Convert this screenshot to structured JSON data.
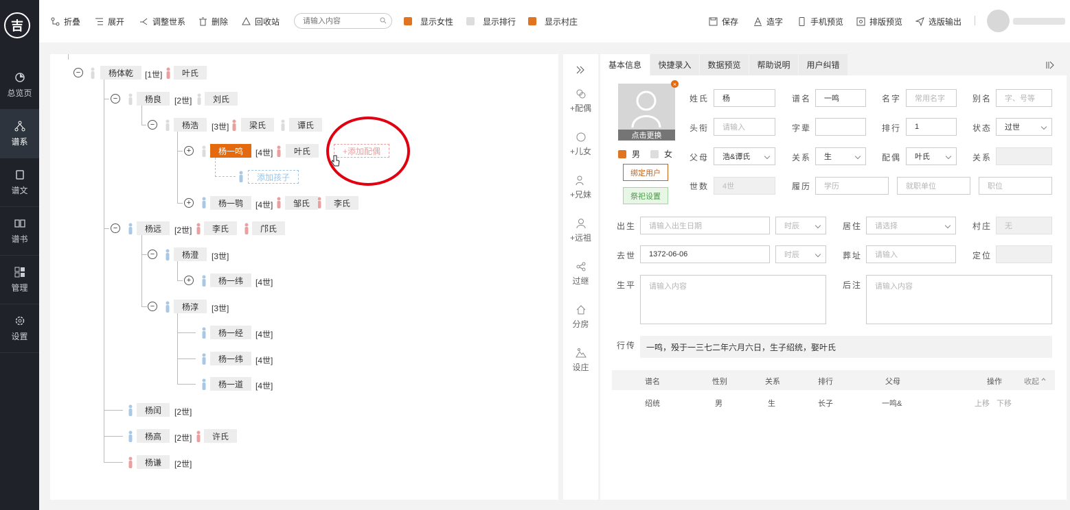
{
  "app": {
    "logo_text": "吉"
  },
  "sidebar": {
    "items": [
      {
        "label": "总览页",
        "icon": "pie-chart-icon"
      },
      {
        "label": "谱系",
        "icon": "tree-icon",
        "active": true
      },
      {
        "label": "谱文",
        "icon": "document-icon"
      },
      {
        "label": "谱书",
        "icon": "book-icon"
      },
      {
        "label": "管理",
        "icon": "grid-icon"
      },
      {
        "label": "设置",
        "icon": "gear-icon"
      }
    ]
  },
  "toolbar": {
    "fold": "折叠",
    "expand": "展开",
    "adjust": "调整世系",
    "delete": "删除",
    "recycle": "回收站",
    "search_placeholder": "请输入内容",
    "show_female": "显示女性",
    "show_rank": "显示排行",
    "show_village": "显示村庄",
    "save": "保存",
    "make_char": "造字",
    "mobile_preview": "手机预览",
    "layout_preview": "排版预览",
    "export": "选版输出"
  },
  "tree": {
    "nodes": {
      "n1": "杨体乾",
      "n1g": "[1世]",
      "n1s": "叶氏",
      "n2": "杨良",
      "n2g": "[2世]",
      "n2s": "刘氏",
      "n3": "杨浩",
      "n3g": "[3世]",
      "n3s1": "梁氏",
      "n3s2": "谭氏",
      "n4": "杨一鸣",
      "n4g": "[4世]",
      "n4s": "叶氏",
      "add_spouse": "+添加配偶",
      "add_child": "添加孩子",
      "n5": "杨一鹗",
      "n5g": "[4世]",
      "n5s1": "邹氏",
      "n5s2": "李氏",
      "n6": "杨远",
      "n6g": "[2世]",
      "n6s1": "李氏",
      "n6s2": "邝氏",
      "n7": "杨澄",
      "n7g": "[3世]",
      "n8": "杨一纬",
      "n8g": "[4世]",
      "n9": "杨淳",
      "n9g": "[3世]",
      "n10": "杨一经",
      "n10g": "[4世]",
      "n11": "杨一纬",
      "n11g": "[4世]",
      "n12": "杨一道",
      "n12g": "[4世]",
      "n13": "杨闰",
      "n13g": "[2世]",
      "n14": "杨高",
      "n14g": "[2世]",
      "n14s": "许氏",
      "n15": "杨谦",
      "n15g": "[2世]"
    }
  },
  "tools": [
    "+配偶",
    "+儿女",
    "+兄妹",
    "+远祖",
    "过继",
    "分房",
    "设庄"
  ],
  "tabs": [
    "基本信息",
    "快捷录入",
    "数据预览",
    "帮助说明",
    "用户纠错"
  ],
  "form": {
    "photo_caption": "点击更换",
    "male": "男",
    "female": "女",
    "bind_user": "绑定用户",
    "ritual": "祭祀设置",
    "labels": {
      "surname": "姓氏",
      "pu_name": "谱名",
      "given": "名字",
      "alias": "别名",
      "title": "头衔",
      "zibei": "字辈",
      "rank": "排行",
      "status": "状态",
      "parents": "父母",
      "relation": "关系",
      "spouse": "配偶",
      "relation2": "关系",
      "generation": "世数",
      "resume": "履历",
      "birth": "出生",
      "residence": "居住",
      "village": "村庄",
      "death": "去世",
      "burial": "葬址",
      "location": "定位",
      "life": "生平",
      "notes": "后注",
      "biography": "行传"
    },
    "values": {
      "surname": "杨",
      "pu_name": "一鸣",
      "rank": "1",
      "status": "过世",
      "parents": "浩&谭氏",
      "relation": "生",
      "spouse": "叶氏",
      "generation": "4世",
      "death_date": "1372-06-06",
      "village": "无",
      "biography": "一鸣，殁于一三七二年六月六日，生子绍统，娶叶氏"
    },
    "placeholders": {
      "given": "常用名字",
      "alias": "字、号等",
      "title": "请输入",
      "education": "学历",
      "employer": "就职单位",
      "position": "职位",
      "birth": "请输入出生日期",
      "hour": "时辰",
      "hour2": "时辰",
      "residence": "请选择",
      "burial": "请输入",
      "life": "请输入内容",
      "notes": "请输入内容"
    }
  },
  "children_table": {
    "headers": [
      "谱名",
      "性别",
      "关系",
      "排行",
      "父母",
      "操作",
      "收起"
    ],
    "rows": [
      {
        "name": "绍统",
        "gender": "男",
        "relation": "生",
        "rank": "长子",
        "parents": "一鸣&",
        "up": "上移",
        "down": "下移"
      }
    ]
  }
}
